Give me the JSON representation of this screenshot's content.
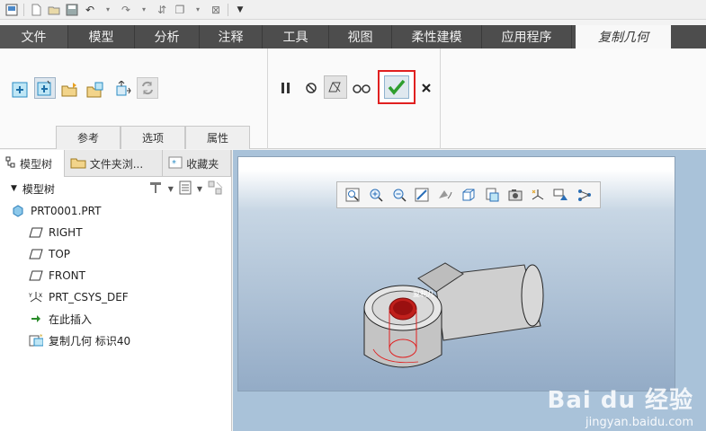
{
  "ribbon_tabs": [
    "文件",
    "模型",
    "分析",
    "注释",
    "工具",
    "视图",
    "柔性建模",
    "应用程序"
  ],
  "active_tab": "复制几何",
  "ribbon_subtabs": [
    "参考",
    "选项",
    "属性"
  ],
  "panel_tabs": [
    "模型树",
    "文件夹浏...",
    "收藏夹"
  ],
  "tree": {
    "header": "模型树",
    "root": "PRT0001.PRT",
    "items": [
      "RIGHT",
      "TOP",
      "FRONT",
      "PRT_CSYS_DEF",
      "在此插入",
      "复制几何 标识40"
    ]
  },
  "viewport": {
    "part_label": "复制几"
  },
  "watermark": {
    "brand": "Bai du 经验",
    "url": "jingyan.baidu.com"
  },
  "colors": {
    "ok_green": "#2e9e2e",
    "highlight_red": "#e02020"
  },
  "icons": [
    "new-icon",
    "open-icon",
    "save-icon",
    "undo-icon",
    "redo-icon",
    "regenerate-icon",
    "windows-icon",
    "close-window-icon",
    "customize-icon"
  ]
}
